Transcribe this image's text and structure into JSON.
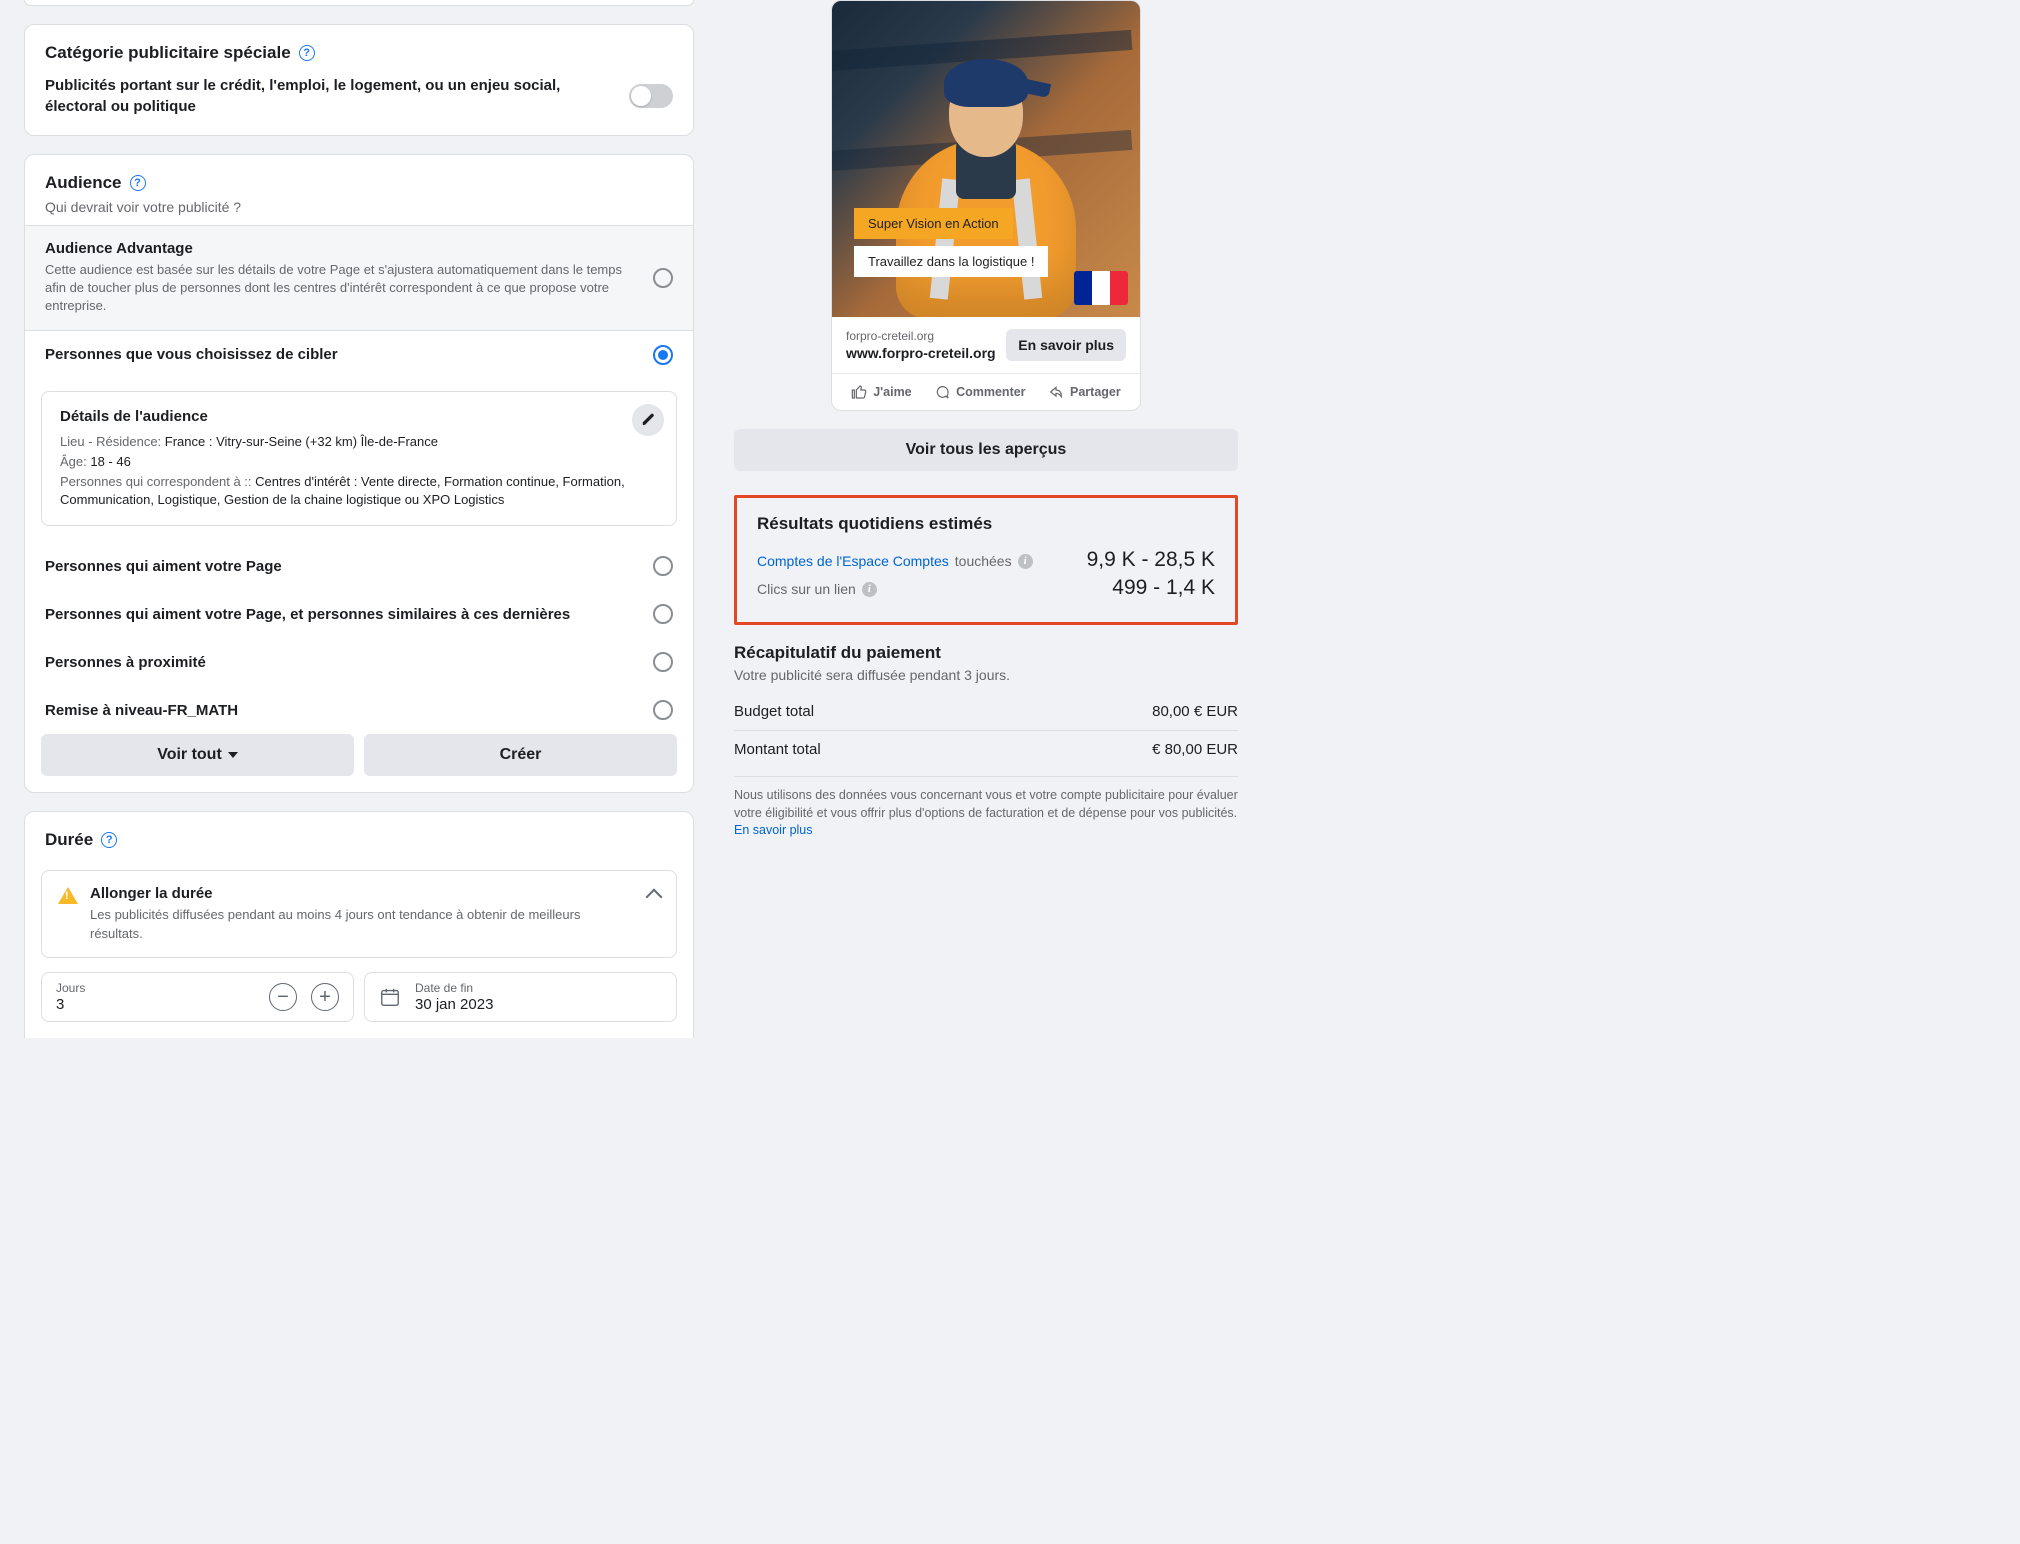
{
  "special_category": {
    "title": "Catégorie publicitaire spéciale",
    "desc": "Publicités portant sur le crédit, l'emploi, le logement, ou un enjeu social, électoral ou politique"
  },
  "audience": {
    "title": "Audience",
    "subtitle": "Qui devrait voir votre publicité ?",
    "advantage": {
      "label": "Audience Advantage",
      "desc": "Cette audience est basée sur les détails de votre Page et s'ajustera automatiquement dans le temps afin de toucher plus de personnes dont les centres d'intérêt correspondent à ce que propose votre entreprise."
    },
    "custom_label": "Personnes que vous choisissez de cibler",
    "details": {
      "title": "Détails de l'audience",
      "loc_label": "Lieu - Résidence: ",
      "loc_value": "France : Vitry-sur-Seine (+32 km) Île-de-France",
      "age_label": "Âge: ",
      "age_value": "18 - 46",
      "match_label": "Personnes qui correspondent à :: ",
      "match_value": "Centres d'intérêt : Vente directe, Formation continue, Formation, Communication, Logistique, Gestion de la chaine logistique ou XPO Logistics"
    },
    "options": {
      "like_page": "Personnes qui aiment votre Page",
      "like_and_similar": "Personnes qui aiment votre Page, et personnes similaires à ces dernières",
      "nearby": "Personnes à proximité",
      "saved_audience": "Remise à niveau-FR_MATH"
    },
    "buttons": {
      "see_all": "Voir tout",
      "create": "Créer"
    }
  },
  "duration": {
    "title": "Durée",
    "extend": {
      "title": "Allonger la durée",
      "desc": "Les publicités diffusées pendant au moins 4 jours ont tendance à obtenir de meilleurs résultats."
    },
    "days_label": "Jours",
    "days_value": "3",
    "end_label": "Date de fin",
    "end_value": "30 jan 2023"
  },
  "preview": {
    "tag1": "Super Vision en Action",
    "tag2": "Travaillez dans la logistique !",
    "domain": "forpro-creteil.org",
    "headline": "www.forpro-creteil.org",
    "cta": "En savoir plus",
    "actions": {
      "like": "J'aime",
      "comment": "Commenter",
      "share": "Partager"
    },
    "see_all": "Voir tous les aperçus"
  },
  "estimates": {
    "title": "Résultats quotidiens estimés",
    "accounts_link": "Comptes de l'Espace Comptes",
    "accounts_suffix": "touchées",
    "accounts_value": "9,9 K - 28,5 K",
    "clicks_label": "Clics sur un lien",
    "clicks_value": "499 - 1,4 K"
  },
  "payment": {
    "title": "Récapitulatif du paiement",
    "subtitle": "Votre publicité sera diffusée pendant 3 jours.",
    "budget_label": "Budget total",
    "budget_value": "80,00 € EUR",
    "total_label": "Montant total",
    "total_value": "€ 80,00 EUR",
    "disclaimer": "Nous utilisons des données vous concernant vous et votre compte publicitaire pour évaluer votre éligibilité et vous offrir plus d'options de facturation et de dépense pour vos publicités. ",
    "learn_more": "En savoir plus"
  }
}
